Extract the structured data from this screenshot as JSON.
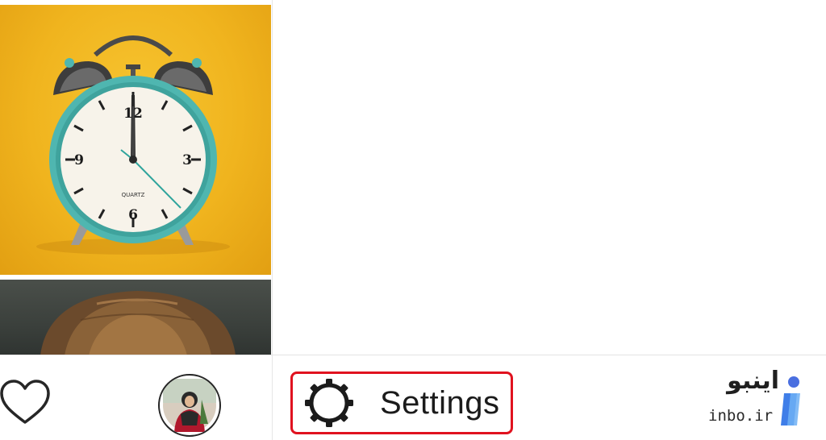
{
  "feed": {
    "posts": [
      {
        "clock_brand": "QUARTZ",
        "numerals": [
          "12",
          "3",
          "6",
          "9"
        ]
      },
      {}
    ]
  },
  "bottom_bar": {
    "heart_icon": "heart-outline-icon",
    "avatar_icon": "profile-avatar"
  },
  "menu": {
    "settings_label": "Settings",
    "settings_icon": "gear-icon"
  },
  "watermark": {
    "name_fa": "اینبو",
    "site": "inbo.ir"
  },
  "colors": {
    "highlight_border": "#e0121f",
    "clock_teal": "#4fb6b0",
    "background_yellow": "#f2b822",
    "logo_blue": "#3f7ee8"
  }
}
